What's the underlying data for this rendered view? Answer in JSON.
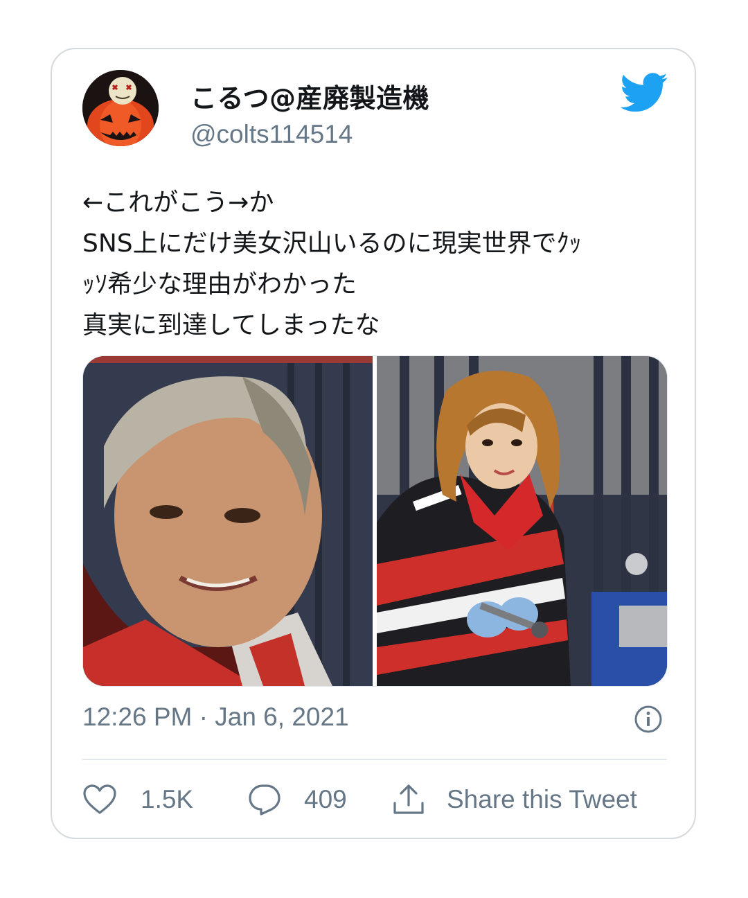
{
  "tweet": {
    "display_name": "こるつ@産廃製造機",
    "handle": "@colts114514",
    "text_lines": [
      "←これがこう→か",
      "SNS上にだけ美女沢山いるのに現実世界でｸｯ",
      "ｯｿ希少な理由がわかった",
      "真実に到達してしまったな"
    ],
    "timestamp": "12:26 PM · Jan 6, 2021",
    "like_count": "1.5K",
    "reply_count": "409",
    "share_label": "Share this Tweet"
  },
  "colors": {
    "twitter_blue": "#1da1f2",
    "text_primary": "#14171a",
    "text_secondary": "#657786",
    "border": "#d5dadf"
  },
  "icons": {
    "brand": "twitter-bird-icon",
    "info": "info-icon",
    "like": "heart-icon",
    "reply": "reply-bubble-icon",
    "share": "share-upload-icon"
  }
}
